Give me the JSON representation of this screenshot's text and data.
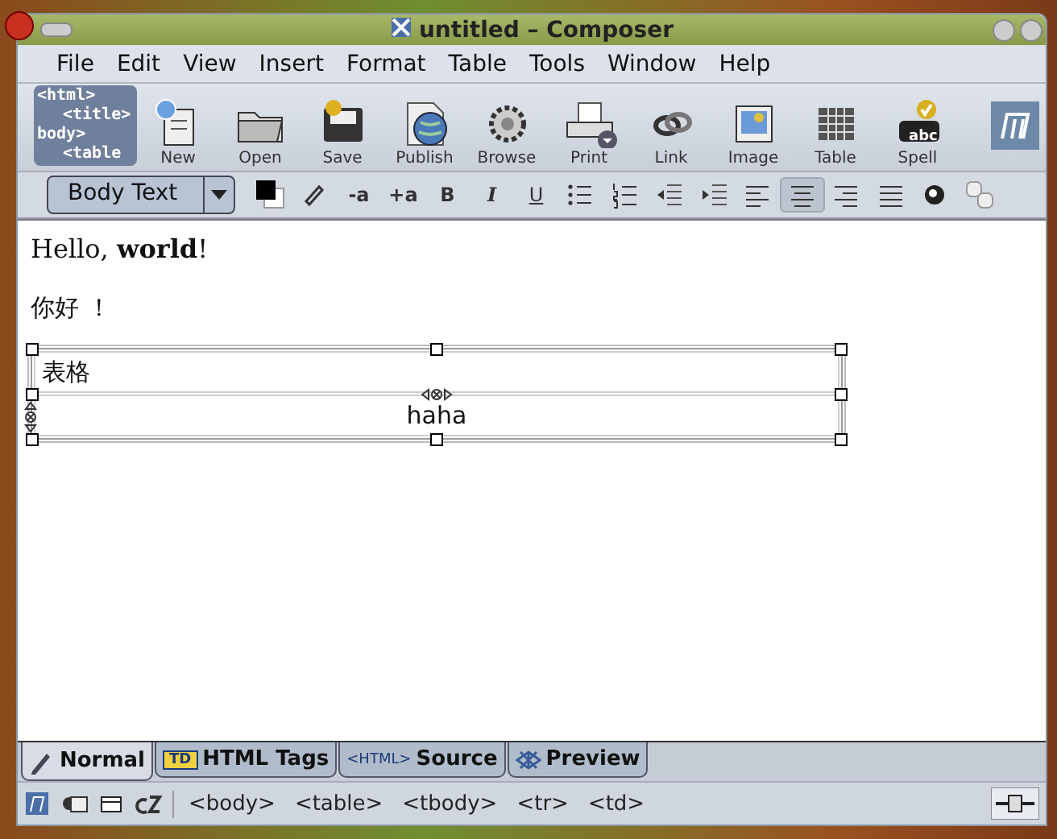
{
  "window": {
    "title": "untitled – Composer"
  },
  "menu": [
    "File",
    "Edit",
    "View",
    "Insert",
    "Format",
    "Table",
    "Tools",
    "Window",
    "Help"
  ],
  "toolbar_art": [
    "<html>",
    "<title>",
    "body>",
    "<table"
  ],
  "toolbar": [
    {
      "kind": "new",
      "label": "New"
    },
    {
      "kind": "open",
      "label": "Open"
    },
    {
      "kind": "save",
      "label": "Save"
    },
    {
      "kind": "publish",
      "label": "Publish"
    },
    {
      "kind": "browse",
      "label": "Browse"
    },
    {
      "kind": "print",
      "label": "Print"
    },
    {
      "kind": "link",
      "label": "Link"
    },
    {
      "kind": "image",
      "label": "Image"
    },
    {
      "kind": "table",
      "label": "Table"
    },
    {
      "kind": "spell",
      "label": "Spell",
      "badge": "abc"
    }
  ],
  "paragraph_style": "Body Text",
  "format_buttons": [
    {
      "kind": "color"
    },
    {
      "kind": "highlight"
    },
    {
      "kind": "text",
      "label": "-a"
    },
    {
      "kind": "text",
      "label": "+a"
    },
    {
      "kind": "bold",
      "label": "B"
    },
    {
      "kind": "italic",
      "label": "I"
    },
    {
      "kind": "underline",
      "label": "U"
    },
    {
      "kind": "bullets"
    },
    {
      "kind": "numbers"
    },
    {
      "kind": "outdent"
    },
    {
      "kind": "indent"
    },
    {
      "kind": "align-left",
      "selected": false
    },
    {
      "kind": "align-center",
      "selected": true
    },
    {
      "kind": "align-right",
      "selected": false
    },
    {
      "kind": "justify",
      "selected": false
    },
    {
      "kind": "anchor"
    },
    {
      "kind": "shapes"
    }
  ],
  "document": {
    "paragraphs": [
      "Hello, **world**!",
      "你好 ！"
    ],
    "table": {
      "selected": true,
      "rows": [
        {
          "text": "表格",
          "kind": "left"
        },
        {
          "text": "haha",
          "kind": "center"
        }
      ]
    }
  },
  "tabs": [
    {
      "label": "Normal",
      "kind": "pen",
      "selected": true
    },
    {
      "label": "HTML Tags",
      "kind": "tag",
      "badge": "TD",
      "selected": false
    },
    {
      "label": "Source",
      "kind": "html",
      "badge": "<HTML>",
      "selected": false
    },
    {
      "label": "Preview",
      "kind": "eye",
      "selected": false
    }
  ],
  "tag_path": [
    "<body>",
    "<table>",
    "<tbody>",
    "<tr>",
    "<td>"
  ]
}
